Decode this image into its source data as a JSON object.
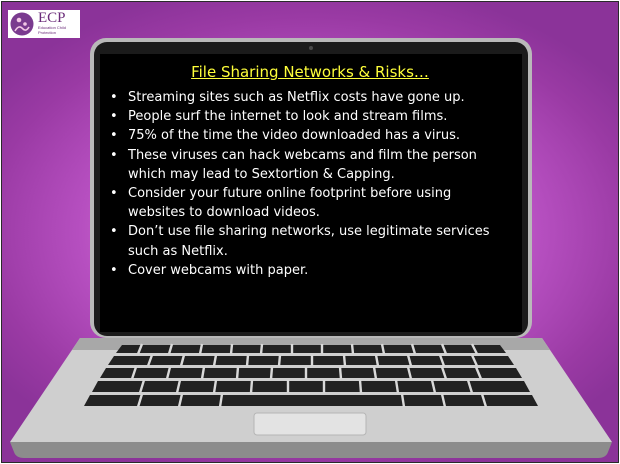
{
  "logo": {
    "title": "ECP",
    "subtitle": "Education Child Protection"
  },
  "slide": {
    "title": "File Sharing Networks & Risks…",
    "bullets": [
      "Streaming sites such as Netflix costs have gone up.",
      "People surf the internet to look and stream films.",
      "75% of the time the video downloaded has a virus.",
      "These viruses can hack webcams and film the person which may lead to Sextortion & Capping.",
      "Consider your future online footprint before using websites to download videos.",
      "Don’t use file sharing networks, use legitimate services such as Netflix.",
      "Cover webcams with paper."
    ]
  },
  "colors": {
    "title": "#ffff3a",
    "text": "#ffffff",
    "screen": "#000000",
    "background_accent": "#b64fc0",
    "logo": "#6a2b79"
  }
}
